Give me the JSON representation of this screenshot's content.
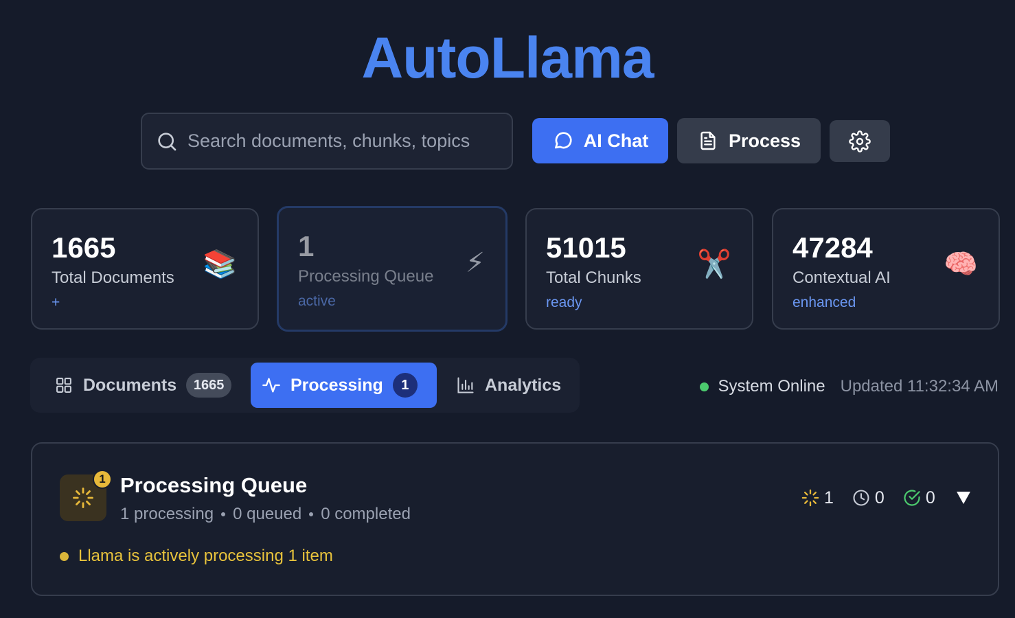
{
  "app": {
    "title": "AutoLlama"
  },
  "search": {
    "placeholder": "Search documents, chunks, topics",
    "value": ""
  },
  "toolbar": {
    "chat_label": "AI Chat",
    "process_label": "Process",
    "settings_icon": "gear-icon"
  },
  "stats": [
    {
      "value": "1665",
      "label": "Total Documents",
      "sub": "+",
      "emoji": "📚"
    },
    {
      "value": "1",
      "label": "Processing Queue",
      "sub": "active",
      "emoji": "⚡"
    },
    {
      "value": "51015",
      "label": "Total Chunks",
      "sub": "ready",
      "emoji": "✂️"
    },
    {
      "value": "47284",
      "label": "Contextual AI",
      "sub": "enhanced",
      "emoji": "🧠"
    }
  ],
  "tabs": [
    {
      "label": "Documents",
      "count": "1665"
    },
    {
      "label": "Processing",
      "count": "1",
      "active": true
    },
    {
      "label": "Analytics"
    }
  ],
  "status": {
    "online": "System Online",
    "updated": "Updated 11:32:34 AM"
  },
  "queue": {
    "badge": "1",
    "title": "Processing Queue",
    "processing": "1 processing",
    "queued": "0 queued",
    "completed": "0 completed",
    "active_message": "Llama is actively processing 1 item",
    "counters": {
      "processing": "1",
      "queued": "0",
      "completed": "0"
    },
    "toggle": "▼"
  },
  "colors": {
    "accent": "#3d6ff2",
    "brand": "#4a84f0",
    "online": "#4ccb6e",
    "warning": "#e8c33c"
  }
}
